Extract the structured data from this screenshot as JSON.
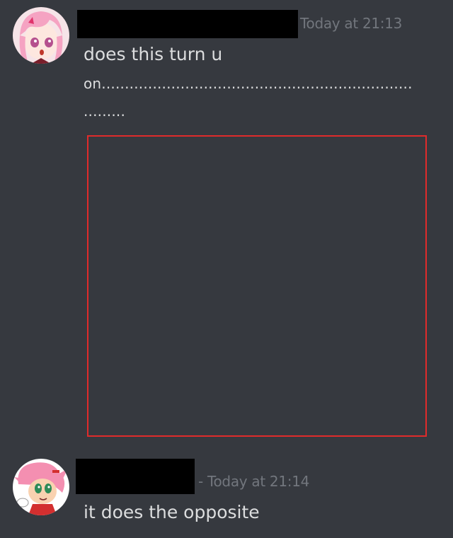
{
  "colors": {
    "background": "#36393f",
    "text": "#dcddde",
    "timestamp": "#72767d",
    "redaction": "#000000",
    "embed_outline": "#e02b2b"
  },
  "messages": [
    {
      "avatar": "pink-haired-anime-girl-avatar",
      "timestamp": "Today at 21:13",
      "lines": [
        "does this turn u",
        "on...................................................................",
        "........."
      ],
      "embed": "empty-image-outline"
    },
    {
      "avatar": "pink-hedgehog-cartoon-avatar",
      "timestamp": "- Today at 21:14",
      "lines": [
        "it does the opposite"
      ]
    }
  ]
}
